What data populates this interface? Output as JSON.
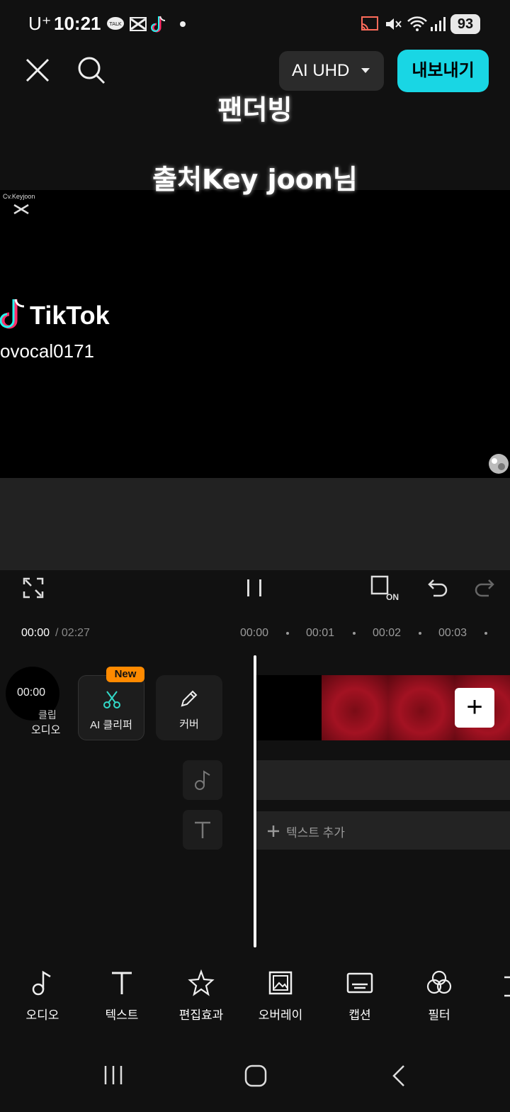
{
  "status_bar": {
    "carrier": "U⁺",
    "time": "10:21",
    "battery": "93",
    "icons": [
      "kakaotalk-icon",
      "capcut-icon",
      "tiktok-icon",
      "dot-icon",
      "cast-icon",
      "mute-icon",
      "wifi-icon",
      "signal-icon"
    ]
  },
  "top_bar": {
    "close_icon": "close-icon",
    "search_icon": "search-icon",
    "quality_label": "AI UHD",
    "export_label": "내보내기",
    "accent_color": "#19d6e4"
  },
  "preview": {
    "overlay_title": "팬더빙",
    "overlay_credit": "출처Key joon님",
    "watermark_small": "Cv.Keyjoon",
    "tiktok_brand": "TikTok",
    "tiktok_handle": "ovocal0171"
  },
  "controls": {
    "fullscreen_icon": "fullscreen-icon",
    "pause_icon": "pause-icon",
    "keyframe_icon": "keyframe-on-icon",
    "keyframe_badge": "ON",
    "undo_icon": "undo-icon",
    "redo_icon": "redo-icon"
  },
  "timeline": {
    "current_time": "00:00",
    "total_time": "/ 02:27",
    "ticks": [
      "00:00",
      "00:01",
      "00:02",
      "00:03"
    ],
    "audio_clip_time": "00:00",
    "audio_clip_label_1": "클립",
    "audio_clip_label_2": "오디오",
    "new_badge": "New",
    "ai_clipper_label": "AI 클리퍼",
    "cover_label": "커버",
    "add_text_label": "텍스트 추가",
    "add_clip_symbol": "+"
  },
  "bottom_toolbar": {
    "items": [
      {
        "label": "오디오",
        "icon": "music-note-icon"
      },
      {
        "label": "텍스트",
        "icon": "text-icon"
      },
      {
        "label": "편집효과",
        "icon": "sparkle-star-icon"
      },
      {
        "label": "오버레이",
        "icon": "overlay-image-icon"
      },
      {
        "label": "캡션",
        "icon": "caption-icon"
      },
      {
        "label": "필터",
        "icon": "filter-icon"
      }
    ]
  },
  "nav_bar": {
    "icons": [
      "recent-apps-icon",
      "home-icon",
      "back-icon"
    ]
  }
}
